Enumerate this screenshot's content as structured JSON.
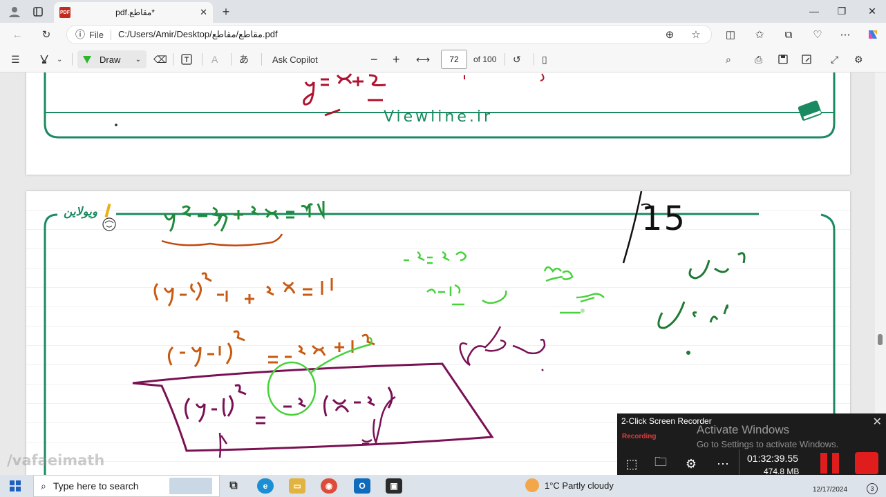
{
  "browser": {
    "tab_title": "pdf.مقاطع*",
    "url_scheme_label": "File",
    "url": "C:/Users/Amir/Desktop/مقاطع/مقاطع.pdf"
  },
  "pdf_toolbar": {
    "draw_label": "Draw",
    "ask_copilot_label": "Ask Copilot",
    "page_number": "72",
    "page_total": "of 100",
    "draw_color": "#2db52d"
  },
  "page_top": {
    "footer_site": "Viewline.ir",
    "handwriting": "y = x² + 2"
  },
  "page_main": {
    "logo_text": "ویولاین",
    "heading_number": "15",
    "accent_color": "#1b8a60",
    "math": {
      "line1": "y² − 2y + 4x = 11",
      "line2": "(y−1)² − 1 + 4x = 11",
      "line3": "(y−1)² = −4x + 12",
      "line4": "(y−1)² = −4 (x − 3)",
      "below_arrow": "3",
      "box_note": "سهمی",
      "green_line1": "4a = −4",
      "green_line2": "a = −1",
      "green_words_right": "دهانه",
      "green_word_down": "سمت",
      "right_word1": "کانون",
      "right_word2": "راس"
    },
    "watermark": "/vafaeimath"
  },
  "recorder": {
    "title": "2-Click Screen Recorder",
    "status": "Recording",
    "time": "01:32:39.55",
    "size": "474.8 MB"
  },
  "windows_activation": {
    "title": "Activate Windows",
    "subtitle": "Go to Settings to activate Windows."
  },
  "taskbar": {
    "search_placeholder": "Type here to search",
    "weather": "1°C  Partly cloudy",
    "date": "12/17/2024",
    "notification_count": "3"
  }
}
